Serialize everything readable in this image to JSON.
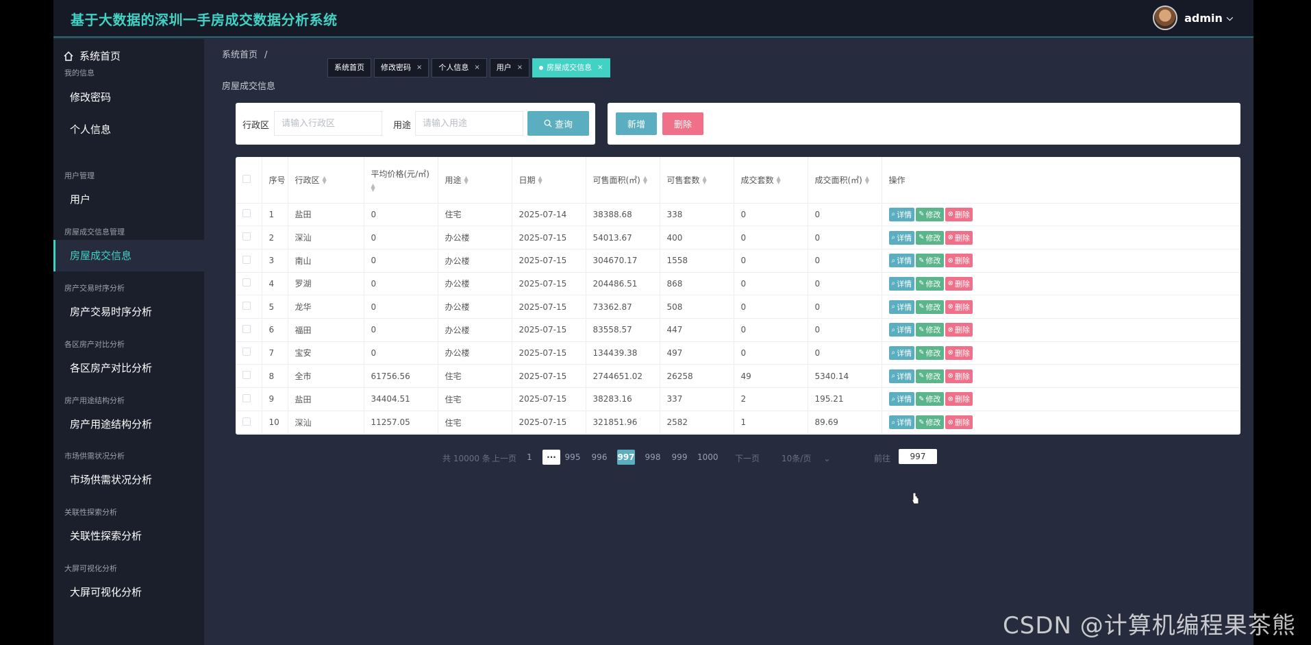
{
  "app": {
    "title": "基于大数据的深圳一手房成交数据分析系统",
    "user": "admin"
  },
  "sidebar": {
    "home": "系统首页",
    "groups": [
      {
        "label": "我的信息",
        "items": [
          "修改密码",
          "个人信息"
        ]
      },
      {
        "label": "用户管理",
        "items": [
          "用户"
        ]
      },
      {
        "label": "房屋成交信息管理",
        "items": [
          "房屋成交信息"
        ]
      },
      {
        "label": "房产交易时序分析",
        "items": [
          "房产交易时序分析"
        ]
      },
      {
        "label": "各区房产对比分析",
        "items": [
          "各区房产对比分析"
        ]
      },
      {
        "label": "房产用途结构分析",
        "items": [
          "房产用途结构分析"
        ]
      },
      {
        "label": "市场供需状况分析",
        "items": [
          "市场供需状况分析"
        ]
      },
      {
        "label": "关联性探索分析",
        "items": [
          "关联性探索分析"
        ]
      },
      {
        "label": "大屏可视化分析",
        "items": [
          "大屏可视化分析"
        ]
      }
    ],
    "active": "房屋成交信息"
  },
  "breadcrumb": {
    "home": "系统首页",
    "sep": "/"
  },
  "tabs": [
    "系统首页",
    "修改密码",
    "个人信息",
    "用户",
    "房屋成交信息"
  ],
  "page_subtitle": "房屋成交信息",
  "search": {
    "district_label": "行政区",
    "district_placeholder": "请输入行政区",
    "usage_label": "用途",
    "usage_placeholder": "请输入用途",
    "query_label": "查询"
  },
  "actions": {
    "add": "新增",
    "delete": "删除"
  },
  "table": {
    "headers": [
      "序号",
      "行政区",
      "平均价格(元/㎡)",
      "用途",
      "日期",
      "可售面积(㎡)",
      "可售套数",
      "成交套数",
      "成交面积(㎡)",
      "操作"
    ],
    "row_actions": {
      "detail": "详情",
      "edit": "修改",
      "delete": "删除"
    },
    "rows": [
      [
        "1",
        "盐田",
        "0",
        "住宅",
        "2025-07-14",
        "38388.68",
        "338",
        "0",
        "0"
      ],
      [
        "2",
        "深汕",
        "0",
        "办公楼",
        "2025-07-15",
        "54013.67",
        "400",
        "0",
        "0"
      ],
      [
        "3",
        "南山",
        "0",
        "办公楼",
        "2025-07-15",
        "304670.17",
        "1558",
        "0",
        "0"
      ],
      [
        "4",
        "罗湖",
        "0",
        "办公楼",
        "2025-07-15",
        "204486.51",
        "868",
        "0",
        "0"
      ],
      [
        "5",
        "龙华",
        "0",
        "办公楼",
        "2025-07-15",
        "73362.87",
        "508",
        "0",
        "0"
      ],
      [
        "6",
        "福田",
        "0",
        "办公楼",
        "2025-07-15",
        "83558.57",
        "447",
        "0",
        "0"
      ],
      [
        "7",
        "宝安",
        "0",
        "办公楼",
        "2025-07-15",
        "134439.38",
        "497",
        "0",
        "0"
      ],
      [
        "8",
        "全市",
        "61756.56",
        "住宅",
        "2025-07-15",
        "2744651.02",
        "26258",
        "49",
        "5340.14"
      ],
      [
        "9",
        "盐田",
        "34404.51",
        "住宅",
        "2025-07-15",
        "38283.16",
        "337",
        "2",
        "195.21"
      ],
      [
        "10",
        "深汕",
        "11257.05",
        "住宅",
        "2025-07-15",
        "321851.96",
        "2582",
        "1",
        "89.69"
      ]
    ]
  },
  "pagination": {
    "total": "共 10000 条",
    "prev": "上一页",
    "first": "1",
    "more": "···",
    "pages": [
      "995",
      "996",
      "997",
      "998",
      "999",
      "1000"
    ],
    "current": "997",
    "next": "下一页",
    "page_size": "10条/页",
    "goto_label": "前往",
    "goto_value": "997"
  },
  "watermark": "CSDN @计算机编程果茶熊"
}
